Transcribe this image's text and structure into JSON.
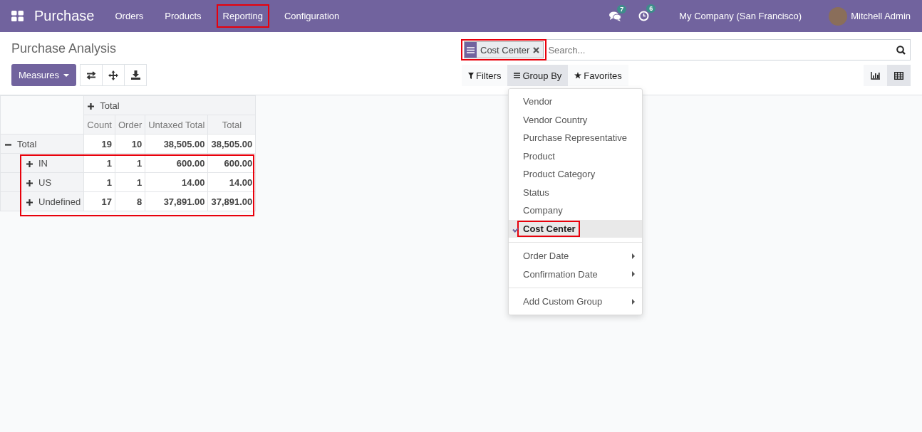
{
  "navbar": {
    "app_name": "Purchase",
    "menu": [
      {
        "label": "Orders",
        "highlighted": false
      },
      {
        "label": "Products",
        "highlighted": false
      },
      {
        "label": "Reporting",
        "highlighted": true
      },
      {
        "label": "Configuration",
        "highlighted": false
      }
    ],
    "messages_count": "7",
    "activities_count": "6",
    "company": "My Company (San Francisco)",
    "user": "Mitchell Admin"
  },
  "control_panel": {
    "title": "Purchase Analysis",
    "measures_button": "Measures",
    "search": {
      "facet": {
        "label": "Cost Center",
        "highlighted": true
      },
      "placeholder": "Search..."
    },
    "filter_buttons": [
      {
        "label": "Filters",
        "kind": "filter",
        "selected": false
      },
      {
        "label": "Group By",
        "kind": "groupby",
        "selected": true
      },
      {
        "label": "Favorites",
        "kind": "favorite",
        "selected": false
      }
    ],
    "views": [
      {
        "kind": "graph",
        "selected": false
      },
      {
        "kind": "pivot",
        "selected": true
      }
    ]
  },
  "group_by_menu": {
    "fields": [
      {
        "label": "Vendor",
        "selected": false,
        "highlighted": false
      },
      {
        "label": "Vendor Country",
        "selected": false,
        "highlighted": false
      },
      {
        "label": "Purchase Representative",
        "selected": false,
        "highlighted": false
      },
      {
        "label": "Product",
        "selected": false,
        "highlighted": false
      },
      {
        "label": "Product Category",
        "selected": false,
        "highlighted": false
      },
      {
        "label": "Status",
        "selected": false,
        "highlighted": false
      },
      {
        "label": "Company",
        "selected": false,
        "highlighted": false
      },
      {
        "label": "Cost Center",
        "selected": true,
        "highlighted": true
      }
    ],
    "date_fields": [
      {
        "label": "Order Date"
      },
      {
        "label": "Confirmation Date"
      }
    ],
    "custom": {
      "label": "Add Custom Group"
    }
  },
  "pivot": {
    "column_group": "Total",
    "measures": [
      "Count",
      "Order",
      "Untaxed Total",
      "Total"
    ],
    "rows": [
      {
        "label": "Total",
        "expanded": true,
        "children_highlighted": true,
        "values": [
          "19",
          "10",
          "38,505.00",
          "38,505.00"
        ],
        "children": [
          {
            "label": "IN",
            "expanded": false,
            "values": [
              "1",
              "1",
              "600.00",
              "600.00"
            ]
          },
          {
            "label": "US",
            "expanded": false,
            "values": [
              "1",
              "1",
              "14.00",
              "14.00"
            ]
          },
          {
            "label": "Undefined",
            "expanded": false,
            "values": [
              "17",
              "8",
              "37,891.00",
              "37,891.00"
            ]
          }
        ]
      }
    ]
  }
}
